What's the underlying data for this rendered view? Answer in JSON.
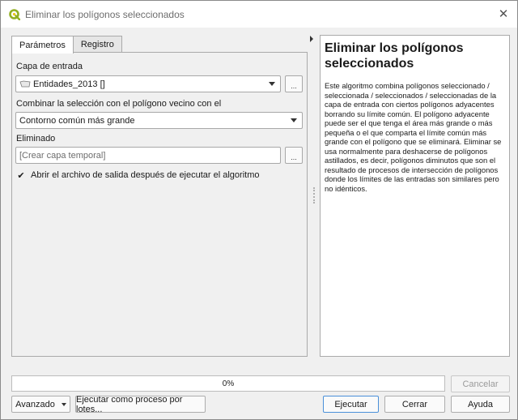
{
  "window": {
    "title": "Eliminar los polígonos seleccionados",
    "close_glyph": "✕",
    "app_icon": "qgis-logo-icon"
  },
  "tabs": [
    {
      "label": "Parámetros",
      "active": true
    },
    {
      "label": "Registro",
      "active": false
    }
  ],
  "params": {
    "input_layer_label": "Capa de entrada",
    "input_layer_value": "Entidades_2013 []",
    "input_layer_icon": "polygon-layer-icon",
    "combine_label": "Combinar la selección con el polígono vecino con el",
    "combine_value": "Contorno común más grande",
    "output_label": "Eliminado",
    "output_placeholder": "[Crear capa temporal]",
    "dots_label": "...",
    "open_output_label": "Abrir el archivo de salida después de ejecutar el algoritmo",
    "open_output_checked": true
  },
  "help": {
    "title": "Eliminar los polígonos seleccionados",
    "body": "Este algoritmo combina polígonos seleccionado / seleccionada / seleccionados / seleccionadas de la capa de entrada con ciertos polígonos adyacentes borrando su límite común. El polígono adyacente puede ser el que tenga el área más grande o más pequeña o el que comparta el límite común más grande con el polígono que se eliminará. Eliminar se usa normalmente para deshacerse de polígonos astillados, es decir, polígonos diminutos que son el resultado de procesos de intersección de polígonos donde los límites de las entradas son similares pero no idénticos."
  },
  "progress": {
    "value": 0,
    "text": "0%"
  },
  "buttons": {
    "cancel": "Cancelar",
    "advanced": "Avanzado",
    "batch": "Ejecutar como proceso por lotes...",
    "run": "Ejecutar",
    "close": "Cerrar",
    "help": "Ayuda"
  },
  "colors": {
    "qgis_green": "#93b023",
    "qgis_yellow": "#f0c419",
    "focus_blue": "#4a90d9"
  }
}
